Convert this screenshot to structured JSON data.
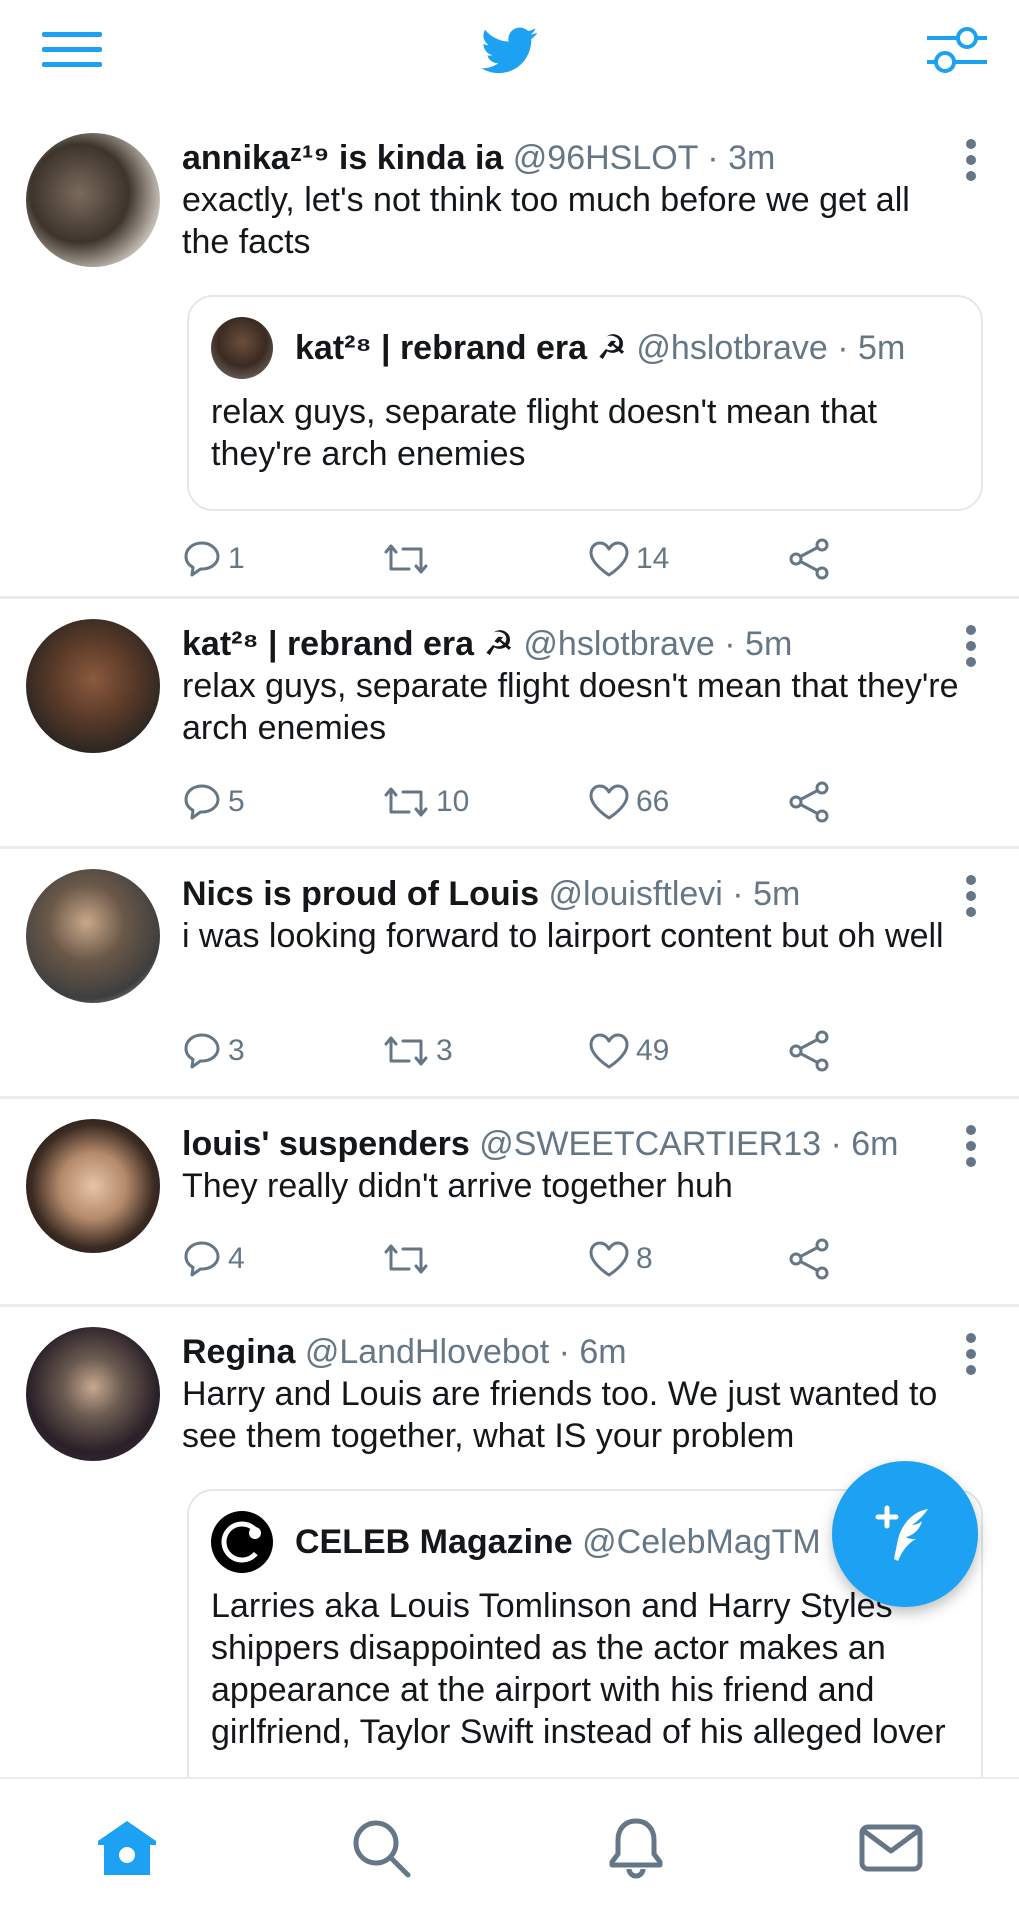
{
  "colors": {
    "accent": "#1da1f2",
    "text": "#14171a",
    "secondary": "#657786",
    "divider": "#e6ecf0"
  },
  "top_bar": {
    "menu_icon": "hamburger-menu-icon",
    "logo_icon": "twitter-bird-icon",
    "filter_icon": "sliders-icon"
  },
  "tweets": [
    {
      "name": "annikaᶻ¹⁹ is kinda ia",
      "handle": "@96HSLOT",
      "sep": "·",
      "time": "3m",
      "text": "exactly, let's not think too much before we get all the facts",
      "quote": {
        "name": "kat²⁸ | rebrand era ☭",
        "handle": "@hslotbrave",
        "sep": "·",
        "time": "5m",
        "text": "relax guys, separate flight doesn't mean that they're arch enemies"
      },
      "replies": "1",
      "retweets": "",
      "likes": "14"
    },
    {
      "name": "kat²⁸ | rebrand era ☭",
      "handle": "@hslotbrave",
      "sep": "·",
      "time": "5m",
      "text": "relax guys, separate flight doesn't mean that they're arch enemies",
      "replies": "5",
      "retweets": "10",
      "likes": "66"
    },
    {
      "name": "Nics is proud of Louis",
      "handle": "@louisftlevi",
      "sep": "·",
      "time": "5m",
      "text": "i was looking forward to lairport content but oh well",
      "replies": "3",
      "retweets": "3",
      "likes": "49"
    },
    {
      "name": "louis' suspenders",
      "handle": "@SWEETCARTIER13",
      "sep": "·",
      "time": "6m",
      "text": "They really didn't arrive together huh",
      "replies": "4",
      "retweets": "",
      "likes": "8"
    },
    {
      "name": "Regina",
      "handle": "@LandHlovebot",
      "sep": "·",
      "time": "6m",
      "text": "Harry and Louis are friends too. We just wanted to see them together, what IS your problem",
      "quote": {
        "name": "CELEB Magazine",
        "handle": "@CelebMagTM",
        "sep": "",
        "time": "",
        "text": "Larries aka Louis Tomlinson and Harry Styles shippers disappointed as the actor makes an appearance at the airport with his friend and girlfriend, Taylor Swift instead of his alleged lover"
      }
    }
  ],
  "bottom_nav": [
    "home-icon",
    "search-icon",
    "notifications-icon",
    "messages-icon"
  ]
}
